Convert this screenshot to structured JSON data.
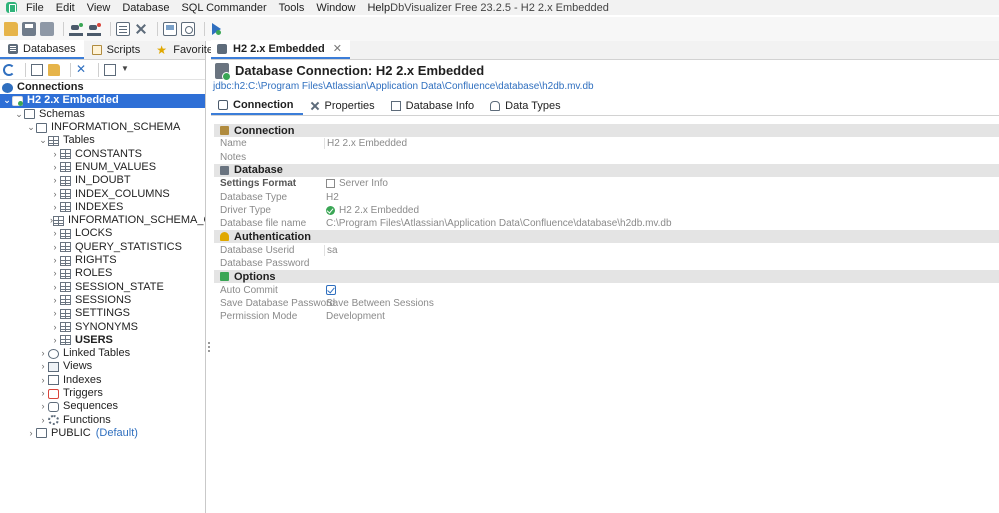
{
  "window": {
    "title": "DbVisualizer Free 23.2.5 - H2 2.x Embedded",
    "menu": [
      "File",
      "Edit",
      "View",
      "Database",
      "SQL Commander",
      "Tools",
      "Window",
      "Help"
    ]
  },
  "left_tabs": [
    {
      "label": "Databases",
      "icon": "database-icon"
    },
    {
      "label": "Scripts",
      "icon": "scripts-icon"
    },
    {
      "label": "Favorites",
      "icon": "star-icon"
    }
  ],
  "tree": {
    "connections_label": "Connections",
    "connection_label": "H2 2.x Embedded",
    "schemas_label": "Schemas",
    "schema_label": "INFORMATION_SCHEMA",
    "tables_label": "Tables",
    "tables": [
      "CONSTANTS",
      "ENUM_VALUES",
      "IN_DOUBT",
      "INDEX_COLUMNS",
      "INDEXES",
      "INFORMATION_SCHEMA_CATALOG",
      "LOCKS",
      "QUERY_STATISTICS",
      "RIGHTS",
      "ROLES",
      "SESSION_STATE",
      "SESSIONS",
      "SETTINGS",
      "SYNONYMS",
      "USERS"
    ],
    "object_groups": [
      "Linked Tables",
      "Views",
      "Indexes",
      "Triggers",
      "Sequences",
      "Functions"
    ],
    "public_schema": {
      "label": "PUBLIC",
      "badge": "(Default)"
    }
  },
  "editor_tab": {
    "label": "H2 2.x Embedded",
    "close": "✕"
  },
  "header": {
    "title": "Database Connection: H2 2.x Embedded",
    "url": "jdbc:h2:C:\\Program Files\\Atlassian\\Application Data\\Confluence\\database\\h2db.mv.db"
  },
  "sub_tabs": [
    "Connection",
    "Properties",
    "Database Info",
    "Data Types"
  ],
  "sections": {
    "connection": {
      "title": "Connection",
      "name_label": "Name",
      "name_value": "H2 2.x Embedded",
      "notes_label": "Notes",
      "notes_value": ""
    },
    "database": {
      "title": "Database",
      "settings_format_label": "Settings Format",
      "settings_format_value": "Server Info",
      "database_type_label": "Database Type",
      "database_type_value": "H2",
      "driver_type_label": "Driver Type",
      "driver_type_value": "H2 2.x Embedded",
      "file_name_label": "Database file name",
      "file_name_value": "C:\\Program Files\\Atlassian\\Application Data\\Confluence\\database\\h2db.mv.db"
    },
    "authentication": {
      "title": "Authentication",
      "userid_label": "Database Userid",
      "userid_value": "sa",
      "password_label": "Database Password",
      "password_value": ""
    },
    "options": {
      "title": "Options",
      "auto_commit_label": "Auto Commit",
      "auto_commit_checked": true,
      "save_password_label": "Save Database Password",
      "save_password_value": "Save Between Sessions",
      "permission_label": "Permission Mode",
      "permission_value": "Development"
    }
  }
}
